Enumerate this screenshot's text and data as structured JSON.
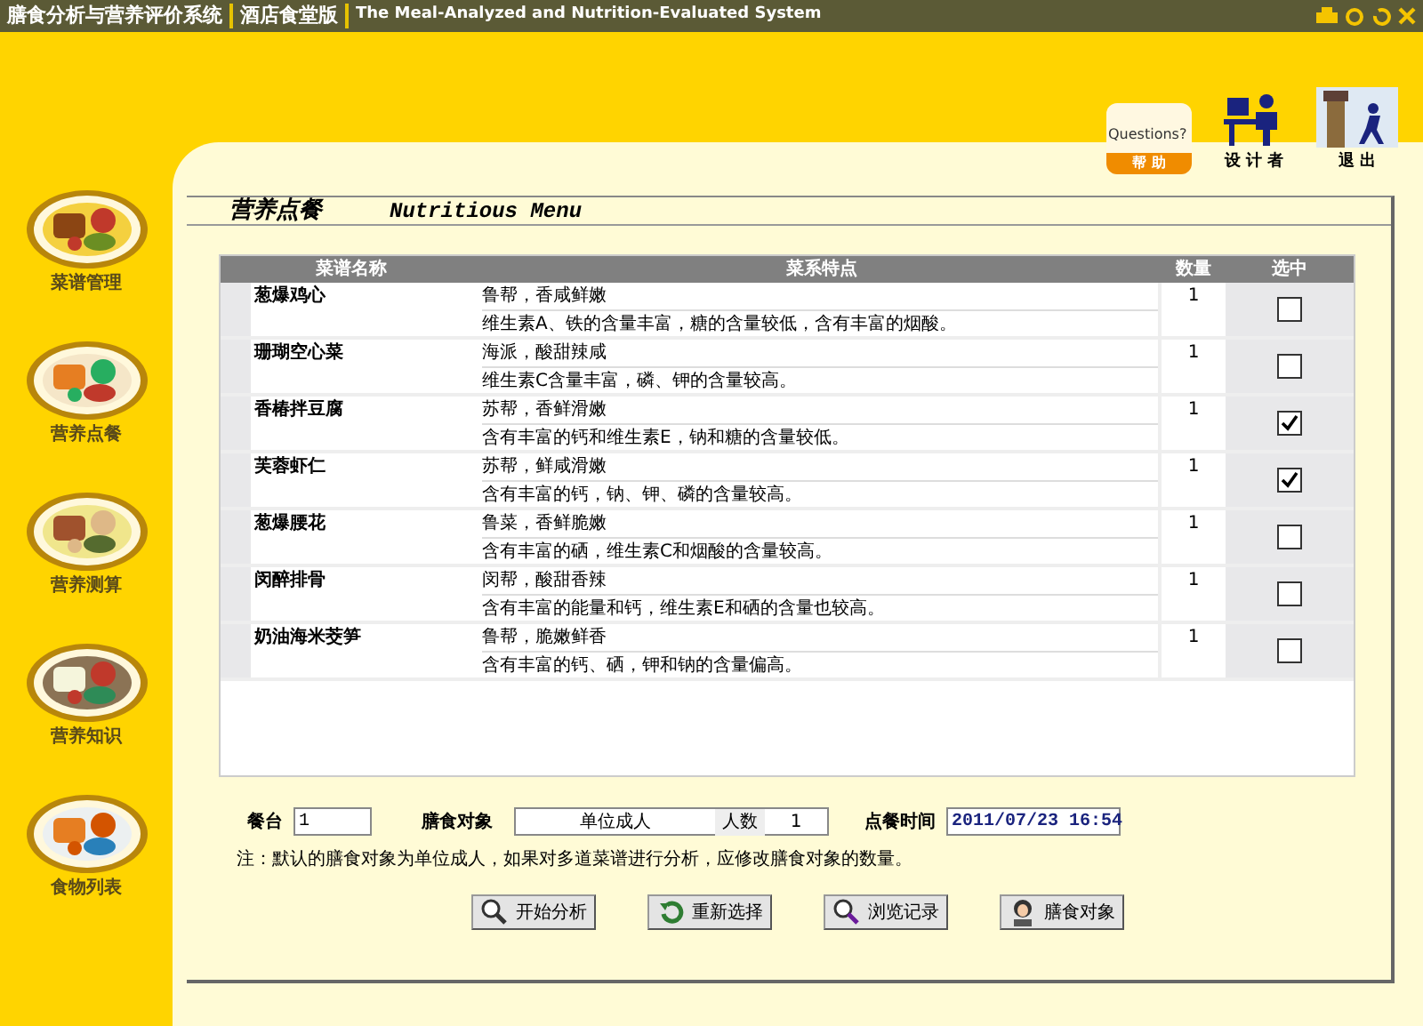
{
  "title_bar": {
    "app_name": "膳食分析与营养评价系统",
    "edition": "酒店食堂版",
    "subtitle": "The Meal-Analyzed and Nutrition-Evaluated System"
  },
  "top_actions": [
    {
      "kind": "help",
      "label": "帮 助",
      "caption": "Questions?"
    },
    {
      "kind": "designer",
      "label": "设 计 者"
    },
    {
      "kind": "exit",
      "label": "退 出"
    }
  ],
  "sidebar": {
    "items": [
      {
        "label": "菜谱管理"
      },
      {
        "label": "营养点餐"
      },
      {
        "label": "营养测算"
      },
      {
        "label": "营养知识"
      },
      {
        "label": "食物列表"
      }
    ]
  },
  "panel": {
    "title": "营养点餐",
    "title_en": "Nutritious Menu"
  },
  "table": {
    "columns": [
      "菜谱名称",
      "菜系特点",
      "数量",
      "选中"
    ],
    "rows": [
      {
        "name": "葱爆鸡心",
        "style": "鲁帮，香咸鲜嫩",
        "note": "维生素A、铁的含量丰富，糖的含量较低，含有丰富的烟酸。",
        "qty": "1",
        "checked": false
      },
      {
        "name": "珊瑚空心菜",
        "style": "海派，酸甜辣咸",
        "note": "维生素C含量丰富，磷、钾的含量较高。",
        "qty": "1",
        "checked": false
      },
      {
        "name": "香椿拌豆腐",
        "style": "苏帮，香鲜滑嫩",
        "note": "含有丰富的钙和维生素E，钠和糖的含量较低。",
        "qty": "1",
        "checked": true
      },
      {
        "name": "芙蓉虾仁",
        "style": "苏帮，鲜咸滑嫩",
        "note": "含有丰富的钙，钠、钾、磷的含量较高。",
        "qty": "1",
        "checked": true
      },
      {
        "name": "葱爆腰花",
        "style": "鲁菜，香鲜脆嫩",
        "note": "含有丰富的硒，维生素C和烟酸的含量较高。",
        "qty": "1",
        "checked": false
      },
      {
        "name": "闵醉排骨",
        "style": "闵帮，酸甜香辣",
        "note": "含有丰富的能量和钙，维生素E和硒的含量也较高。",
        "qty": "1",
        "checked": false
      },
      {
        "name": "奶油海米茭笋",
        "style": "鲁帮，脆嫩鲜香",
        "note": "含有丰富的钙、硒，钾和钠的含量偏高。",
        "qty": "1",
        "checked": false
      }
    ]
  },
  "form": {
    "table_label": "餐台",
    "table_value": "1",
    "target_label": "膳食对象",
    "target_value": "单位成人",
    "count_label": "人数",
    "count_value": "1",
    "time_label": "点餐时间",
    "time_value": "2011/07/23 16:54"
  },
  "note": "注：默认的膳食对象为单位成人，如果对多道菜谱进行分析，应修改膳食对象的数量。",
  "buttons": [
    {
      "kind": "analyze",
      "label": "开始分析"
    },
    {
      "kind": "reset",
      "label": "重新选择"
    },
    {
      "kind": "browse",
      "label": "浏览记录"
    },
    {
      "kind": "target",
      "label": "膳食对象"
    }
  ]
}
